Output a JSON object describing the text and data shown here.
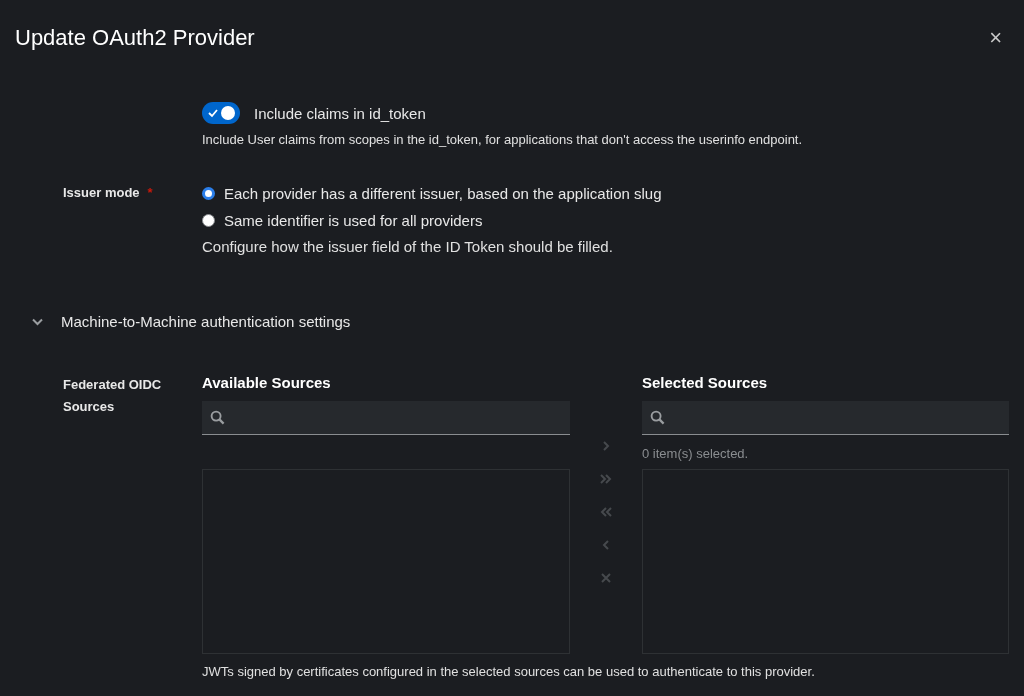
{
  "dialog": {
    "title": "Update OAuth2 Provider",
    "close_label": "×"
  },
  "include_claims": {
    "label": "Include claims in id_token",
    "on": true,
    "help": "Include User claims from scopes in the id_token, for applications that don't access the userinfo endpoint."
  },
  "issuer_mode": {
    "label": "Issuer mode",
    "required": true,
    "required_mark": "*",
    "options": [
      {
        "label": "Each provider has a different issuer, based on the application slug",
        "selected": true
      },
      {
        "label": "Same identifier is used for all providers",
        "selected": false
      }
    ],
    "help": "Configure how the issuer field of the ID Token should be filled."
  },
  "section": {
    "title": "Machine-to-Machine authentication settings",
    "expanded": true
  },
  "federated_sources": {
    "label_lines": [
      "Federated OIDC",
      "Sources"
    ],
    "available": {
      "title": "Available Sources"
    },
    "selected": {
      "title": "Selected Sources",
      "status": "0 item(s) selected."
    },
    "controls": [
      {
        "kind": "add",
        "disabled": true
      },
      {
        "kind": "add_all",
        "disabled": true
      },
      {
        "kind": "remove_all",
        "disabled": true
      },
      {
        "kind": "remove",
        "disabled": true
      },
      {
        "kind": "clear",
        "disabled": true
      }
    ],
    "help": "JWTs signed by certificates configured in the selected sources can be used to authenticate to this provider."
  }
}
